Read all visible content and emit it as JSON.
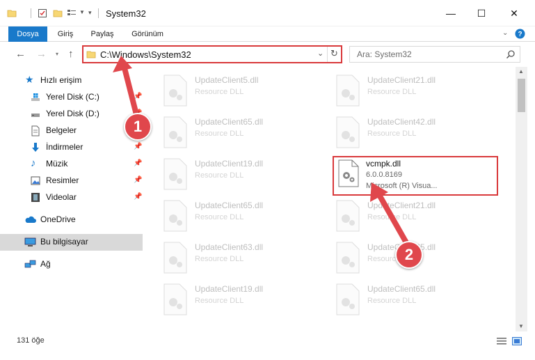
{
  "window": {
    "title": "System32",
    "minimize_glyph": "—",
    "maximize_glyph": "☐",
    "close_glyph": "✕"
  },
  "ribbon": {
    "tabs": [
      "Dosya",
      "Giriş",
      "Paylaş",
      "Görünüm"
    ]
  },
  "address": {
    "path": "C:\\Windows\\System32",
    "search_placeholder": "Ara: System32"
  },
  "nav": {
    "quick_access": "Hızlı erişim",
    "items": [
      "Yerel Disk (C:)",
      "Yerel Disk (D:)",
      "Belgeler",
      "İndirmeler",
      "Müzik",
      "Resimler",
      "Videolar"
    ],
    "onedrive": "OneDrive",
    "this_pc": "Bu bilgisayar",
    "network": "Ağ"
  },
  "files": {
    "left": [
      {
        "name": "UpdateClient5.dll",
        "type": "Resource DLL"
      },
      {
        "name": "UpdateClient65.dll",
        "type": "Resource DLL"
      },
      {
        "name": "UpdateClient19.dll",
        "type": "Resource DLL"
      },
      {
        "name": "UpdateClient65.dll",
        "type": "Resource DLL"
      },
      {
        "name": "UpdateClient63.dll",
        "type": "Resource DLL"
      },
      {
        "name": "UpdateClient19.dll",
        "type": "Resource DLL"
      }
    ],
    "right": [
      {
        "name": "UpdateClient21.dll",
        "type": "Resource DLL"
      },
      {
        "name": "UpdateClient42.dll",
        "type": "Resource DLL"
      },
      {
        "name": "UpdateClient21.dll",
        "type": "Resource DLL"
      },
      {
        "name": "UpdateClient65.dll",
        "type": "Resource DLL"
      },
      {
        "name": "UpdateClient65.dll",
        "type": "Resource DLL"
      }
    ],
    "highlighted": {
      "name": "vcmpk.dll",
      "version": "6.0.0.8169",
      "description": "Microsoft (R) Visua..."
    }
  },
  "status": {
    "item_count": "131 öğe"
  },
  "callouts": [
    "1",
    "2"
  ],
  "colors": {
    "accent": "#1979ca",
    "highlight": "#d9383a",
    "callout": "#e0474c"
  }
}
